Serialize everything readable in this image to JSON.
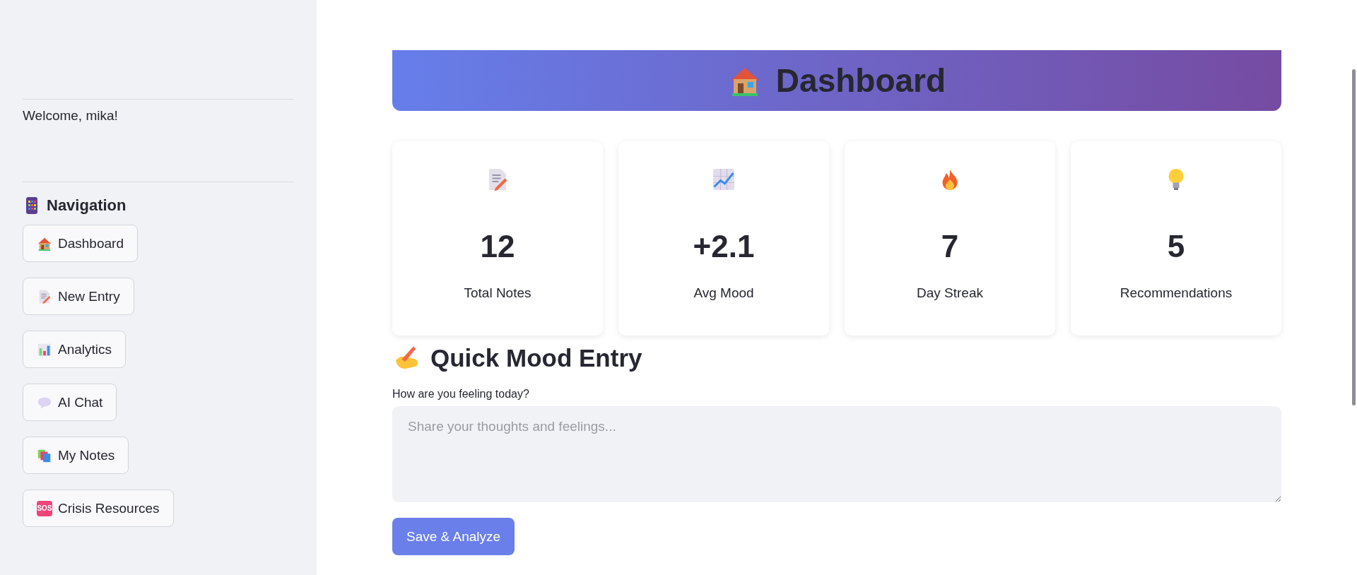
{
  "sidebar": {
    "welcome": "Welcome, mika!",
    "nav_title": "Navigation",
    "items": [
      {
        "label": "Dashboard",
        "kind": "house"
      },
      {
        "label": "New Entry",
        "kind": "memo"
      },
      {
        "label": "Analytics",
        "kind": "bars"
      },
      {
        "label": "AI Chat",
        "kind": "bubble"
      },
      {
        "label": "My Notes",
        "kind": "books"
      },
      {
        "label": "Crisis Resources",
        "kind": "sos",
        "badge": "SOS"
      }
    ]
  },
  "banner": {
    "title": "Dashboard"
  },
  "stats": [
    {
      "value": "12",
      "label": "Total Notes",
      "kind": "memo"
    },
    {
      "value": "+2.1",
      "label": "Avg Mood",
      "kind": "trend"
    },
    {
      "value": "7",
      "label": "Day Streak",
      "kind": "fire"
    },
    {
      "value": "5",
      "label": "Recommendations",
      "kind": "bulb"
    }
  ],
  "quick_entry": {
    "heading": "Quick Mood Entry",
    "field_label": "How are you feeling today?",
    "placeholder": "Share your thoughts and feelings...",
    "button": "Save & Analyze"
  }
}
